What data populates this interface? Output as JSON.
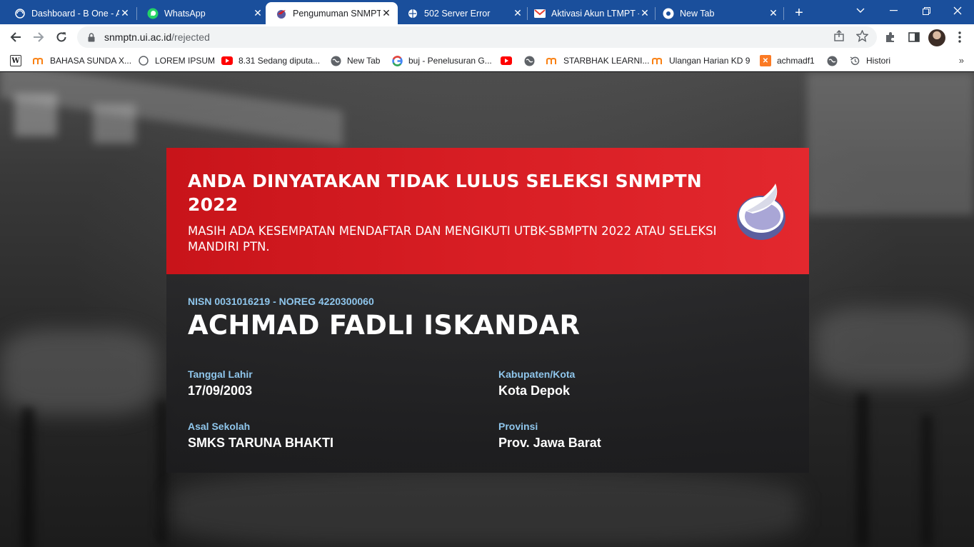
{
  "browser": {
    "tabs": [
      {
        "title": "Dashboard - B One - A",
        "icon": "globe-icon"
      },
      {
        "title": "WhatsApp",
        "icon": "whatsapp-icon"
      },
      {
        "title": "Pengumuman SNMPT",
        "icon": "snmptn-icon"
      },
      {
        "title": "502 Server Error",
        "icon": "globe-icon"
      },
      {
        "title": "Aktivasi Akun LTMPT -",
        "icon": "gmail-icon"
      },
      {
        "title": "New Tab",
        "icon": "chrome-icon"
      }
    ],
    "active_tab": 2,
    "url_domain": "snmptn.ui.ac.id",
    "url_path": "/rejected",
    "bookmarks": [
      {
        "label": "",
        "icon": "wikipedia-icon"
      },
      {
        "label": "BAHASA SUNDA X...",
        "icon": "moodle-icon"
      },
      {
        "label": "LOREM IPSUM",
        "icon": "globe-icon"
      },
      {
        "label": "8.31 Sedang diputa...",
        "icon": "youtube-icon"
      },
      {
        "label": "New Tab",
        "icon": "globe-icon"
      },
      {
        "label": "buj - Penelusuran G...",
        "icon": "google-icon"
      },
      {
        "label": "",
        "icon": "youtube-icon"
      },
      {
        "label": "",
        "icon": "globe-icon"
      },
      {
        "label": "STARBHAK LEARNI...",
        "icon": "moodle-icon"
      },
      {
        "label": "Ulangan Harian KD 9",
        "icon": "moodle-icon"
      },
      {
        "label": "achmadf1",
        "icon": "xampp-icon"
      },
      {
        "label": "",
        "icon": "globe-icon"
      },
      {
        "label": "Histori",
        "icon": "history-icon"
      }
    ],
    "more_bookmarks": "»"
  },
  "announcement": {
    "headline": "ANDA DINYATAKAN TIDAK LULUS SELEKSI SNMPTN 2022",
    "subline": "MASIH ADA KESEMPATAN MENDAFTAR DAN MENGIKUTI UTBK-SBMPTN 2022 ATAU SELEKSI MANDIRI PTN.",
    "banner_color": "#d81e24",
    "label_color": "#8fc6ec"
  },
  "student": {
    "id_line": "NISN 0031016219 - NOREG 4220300060",
    "name": "ACHMAD FADLI ISKANDAR",
    "birth_date_label": "Tanggal Lahir",
    "birth_date": "17/09/2003",
    "city_label": "Kabupaten/Kota",
    "city": "Kota Depok",
    "school_label": "Asal Sekolah",
    "school": "SMKS TARUNA BHAKTI",
    "province_label": "Provinsi",
    "province": "Prov. Jawa Barat"
  }
}
